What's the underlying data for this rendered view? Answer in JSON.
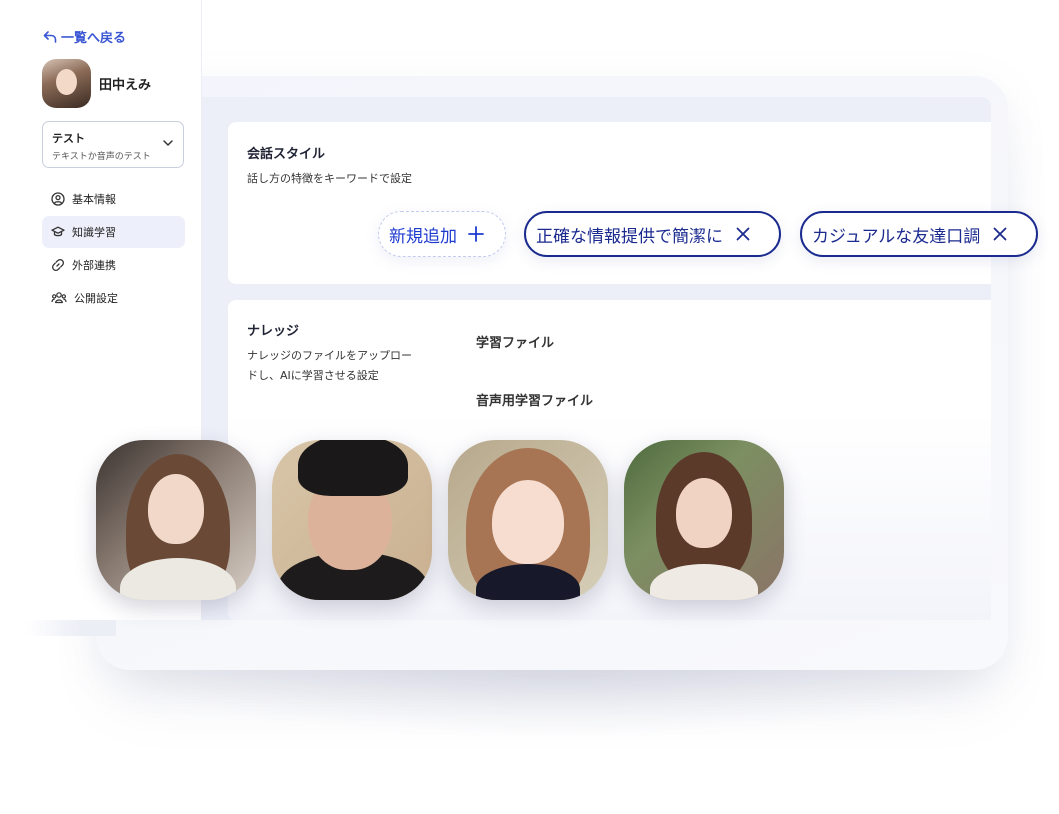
{
  "sidebar": {
    "back_label": "一覧へ戻る",
    "profile_name": "田中えみ",
    "select": {
      "title": "テスト",
      "subtitle": "テキストか音声のテスト"
    },
    "nav": [
      {
        "label": "基本情報",
        "icon": "user-circle-icon",
        "active": false
      },
      {
        "label": "知識学習",
        "icon": "graduation-cap-icon",
        "active": true
      },
      {
        "label": "外部連携",
        "icon": "link-icon",
        "active": false
      },
      {
        "label": "公開設定",
        "icon": "users-icon",
        "active": false
      }
    ]
  },
  "conversation_style": {
    "title": "会話スタイル",
    "description": "話し方の特徴をキーワードで設定",
    "add_label": "新規追加",
    "tags": [
      "正確な情報提供で簡潔に",
      "カジュアルな友達口調"
    ]
  },
  "knowledge": {
    "title": "ナレッジ",
    "description_line1": "ナレッジのファイルをアップロー",
    "description_line2": "ドし、AIに学習させる設定",
    "learning_file_label": "学習ファイル",
    "voice_learning_file_label": "音声用学習ファイル"
  },
  "colors": {
    "accent": "#3a56d4",
    "tag_border": "#1a2a8f",
    "active_nav_bg": "#edf0fb",
    "content_bg": "#eceef8"
  },
  "character_tiles": [
    {
      "name": "character-portrait-1"
    },
    {
      "name": "character-portrait-2"
    },
    {
      "name": "character-portrait-3"
    },
    {
      "name": "character-portrait-4"
    }
  ]
}
